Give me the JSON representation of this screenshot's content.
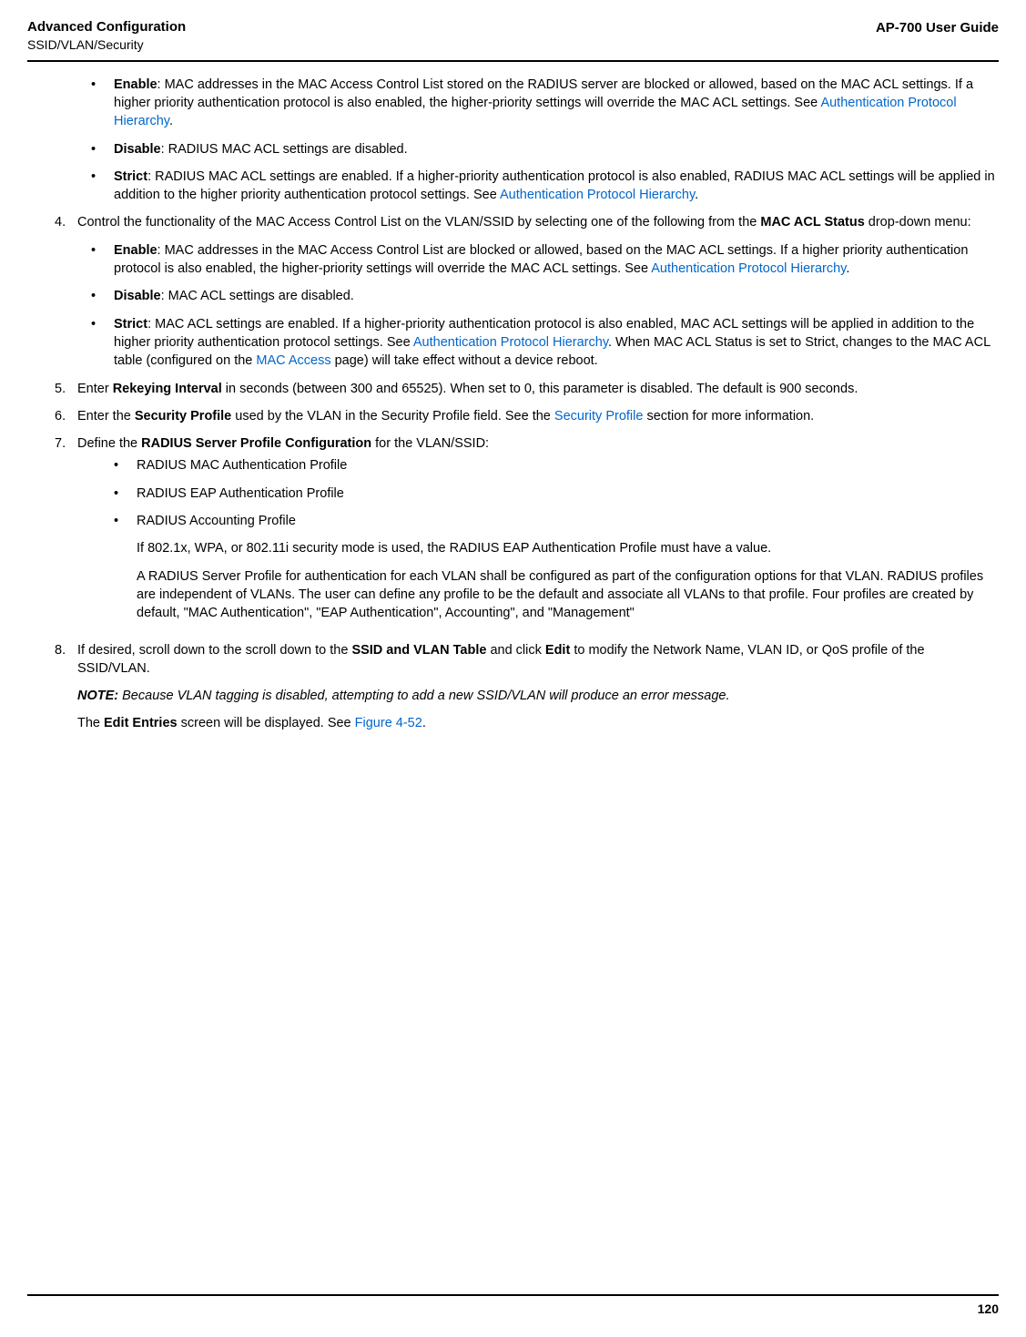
{
  "header": {
    "title": "Advanced Configuration",
    "subtitle": "SSID/VLAN/Security",
    "guide": "AP-700 User Guide"
  },
  "items": {
    "enable1": {
      "label": "Enable",
      "text": ": MAC addresses in the MAC Access Control List stored on the RADIUS server are blocked or allowed, based on the MAC ACL settings. If a higher priority authentication protocol is also enabled, the higher-priority settings will override the MAC ACL settings. See ",
      "link": "Authentication Protocol Hierarchy",
      "after": "."
    },
    "disable1": {
      "label": "Disable",
      "text": ": RADIUS MAC ACL settings are disabled."
    },
    "strict1": {
      "label": "Strict",
      "text": ": RADIUS MAC ACL settings are enabled. If a higher-priority authentication protocol is also enabled, RADIUS MAC ACL settings will be applied in addition to the higher priority authentication protocol settings. See ",
      "link": "Authentication Protocol Hierarchy",
      "after": "."
    },
    "item4": {
      "num": "4.",
      "text1": "Control the functionality of the MAC Access Control List on the VLAN/SSID by selecting one of the following from the ",
      "bold": "MAC ACL Status",
      "text2": " drop-down menu:"
    },
    "enable2": {
      "label": "Enable",
      "text": ": MAC addresses in the MAC Access Control List are blocked or allowed, based on the MAC ACL settings. If a higher priority authentication protocol is also enabled, the higher-priority settings will override the MAC ACL settings. See ",
      "link": "Authentication Protocol Hierarchy",
      "after": "."
    },
    "disable2": {
      "label": "Disable",
      "text": ": MAC ACL settings are disabled."
    },
    "strict2": {
      "label": "Strict",
      "text": ": MAC ACL settings are enabled. If a higher-priority authentication protocol is also enabled, MAC ACL settings will be applied in addition to the higher priority authentication protocol settings. See ",
      "link1": "Authentication Protocol Hierarchy",
      "text2": ". When MAC ACL Status is set to Strict, changes to the MAC ACL table (configured on the ",
      "link2": "MAC Access",
      "text3": " page) will take effect without a device reboot."
    },
    "item5": {
      "num": "5.",
      "text1": "Enter ",
      "bold": "Rekeying Interval",
      "text2": " in seconds (between 300 and 65525). When set to 0, this parameter is disabled. The default is 900 seconds."
    },
    "item6": {
      "num": "6.",
      "text1": "Enter the ",
      "bold": "Security Profile",
      "text2": " used by the VLAN in the Security Profile field. See the ",
      "link": "Security Profile",
      "text3": " section for more information."
    },
    "item7": {
      "num": "7.",
      "text1": "Define the ",
      "bold": "RADIUS Server Profile Configuration",
      "text2": " for the VLAN/SSID:"
    },
    "sub1": "RADIUS MAC Authentication Profile",
    "sub2": "RADIUS EAP Authentication Profile",
    "sub3": "RADIUS Accounting Profile",
    "para1": "If 802.1x, WPA, or 802.11i security mode is used, the RADIUS EAP Authentication Profile must have a value.",
    "para2": "A RADIUS Server Profile for authentication for each VLAN shall be configured as part of the configuration options for that VLAN. RADIUS profiles are independent of VLANs. The user can define any profile to be the default and associate all VLANs to that profile. Four profiles are created by default, \"MAC Authentication\", \"EAP Authentication\", Accounting\", and \"Management\"",
    "item8": {
      "num": "8.",
      "text1": "If desired, scroll down to the scroll down to the ",
      "bold1": "SSID and VLAN Table",
      "text2": " and click ",
      "bold2": "Edit",
      "text3": " to modify the Network Name, VLAN ID, or QoS profile of the SSID/VLAN."
    },
    "note": {
      "label": "NOTE:",
      "text": " Because VLAN tagging is disabled, attempting to add a new SSID/VLAN will produce an error message."
    },
    "final": {
      "text1": "The ",
      "bold": "Edit Entries",
      "text2": " screen will be displayed. See ",
      "link": "Figure 4-52",
      "after": "."
    }
  },
  "pageNumber": "120"
}
